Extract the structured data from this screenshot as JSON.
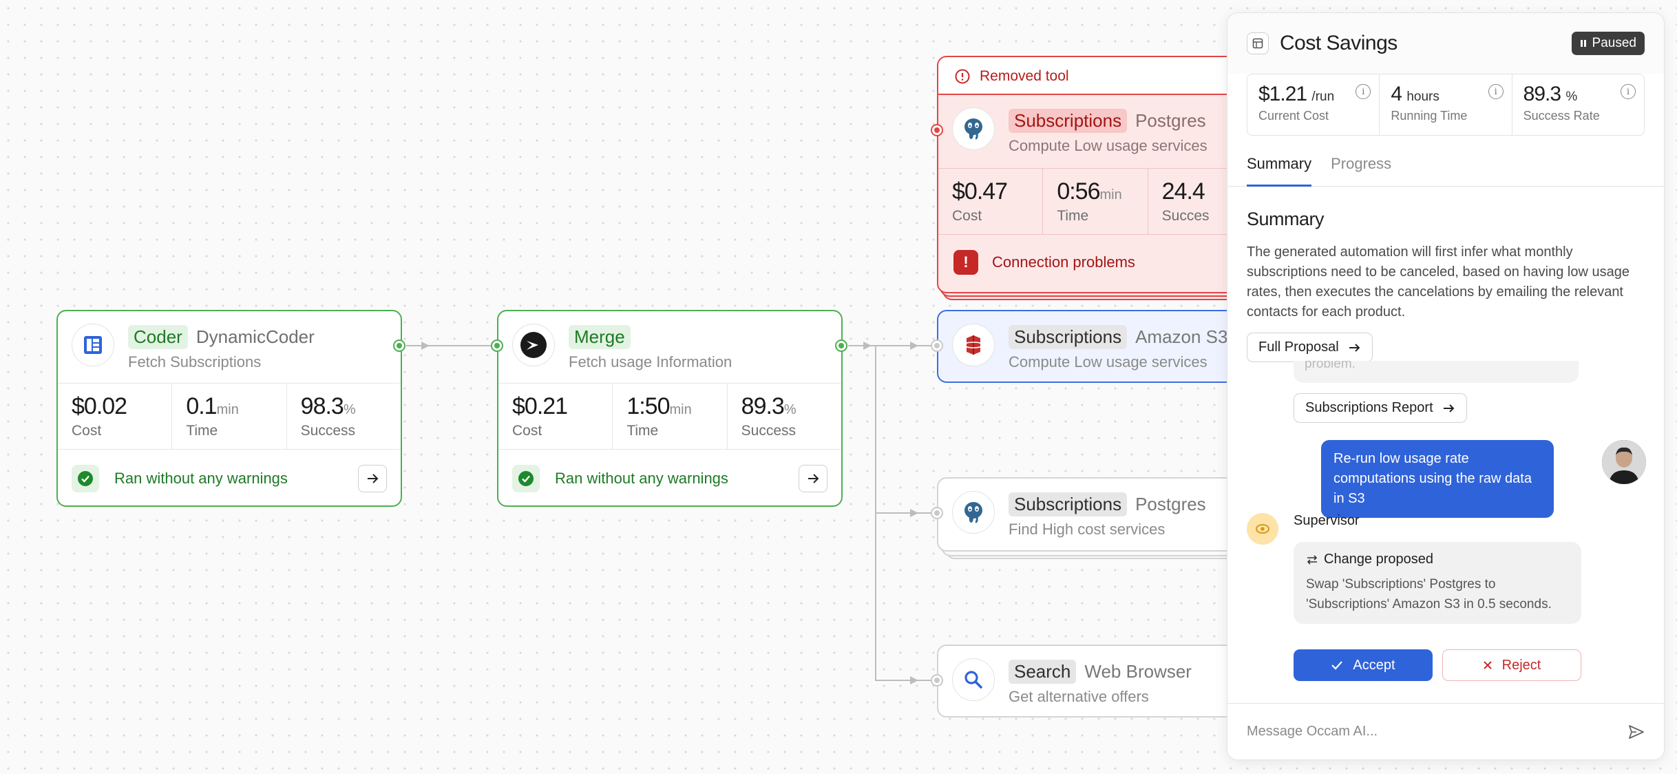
{
  "flow": {
    "coder_node": {
      "tag": "Coder",
      "tool": "DynamicCoder",
      "subtitle": "Fetch Subscriptions",
      "cost": "$0.02",
      "cost_label": "Cost",
      "time": "0.1",
      "time_unit": "min",
      "time_label": "Time",
      "success": "98.3",
      "success_unit": "%",
      "success_label": "Success",
      "status": "Ran without any warnings"
    },
    "merge_node": {
      "tag": "Merge",
      "subtitle": "Fetch usage Information",
      "cost": "$0.21",
      "cost_label": "Cost",
      "time": "1:50",
      "time_unit": "min",
      "time_label": "Time",
      "success": "89.3",
      "success_unit": "%",
      "success_label": "Success",
      "status": "Ran without any warnings"
    },
    "removed_node": {
      "banner": "Removed tool",
      "tag": "Subscriptions",
      "tool": "Postgres",
      "subtitle": "Compute Low usage services",
      "cost": "$0.47",
      "cost_label": "Cost",
      "time": "0:56",
      "time_unit": "min",
      "time_label": "Time",
      "success": "24.4",
      "success_label": "Succes",
      "error": "Connection problems"
    },
    "s3_node": {
      "tag": "Subscriptions",
      "tool": "Amazon S3",
      "subtitle": "Compute Low usage services"
    },
    "postgres_node": {
      "tag": "Subscriptions",
      "tool": "Postgres",
      "subtitle": "Find High cost services"
    },
    "search_node": {
      "tag": "Search",
      "tool": "Web Browser",
      "subtitle": "Get alternative offers"
    }
  },
  "panel": {
    "title": "Cost Savings",
    "status_badge": "Paused",
    "stats": [
      {
        "value": "$1.21",
        "unit": "/run",
        "label": "Current Cost"
      },
      {
        "value": "4",
        "unit": "hours",
        "label": "Running Time"
      },
      {
        "value": "89.3",
        "unit": "%",
        "label": "Success Rate"
      }
    ],
    "tabs": [
      "Summary",
      "Progress"
    ],
    "active_tab": "Summary",
    "summary_heading": "Summary",
    "summary_text": "The generated automation will first infer what monthly subscriptions need to be canceled, based on having low usage rates, then executes the cancelations by emailing the relevant contacts for each product.",
    "full_proposal_label": "Full Proposal",
    "faded_text": "problem.",
    "report_label": "Subscriptions Report",
    "user_message": "Re-run low usage rate computations using the raw data in S3",
    "supervisor_name": "Supervisor",
    "change_title": "Change proposed",
    "change_text": "Swap 'Subscriptions' Postgres to 'Subscriptions' Amazon S3 in 0.5 seconds.",
    "accept_label": "Accept",
    "reject_label": "Reject",
    "composer_placeholder": "Message Occam AI..."
  },
  "colors": {
    "success_green": "#4caf50",
    "accent_blue": "#2f63d9",
    "error_red": "#e24646"
  }
}
